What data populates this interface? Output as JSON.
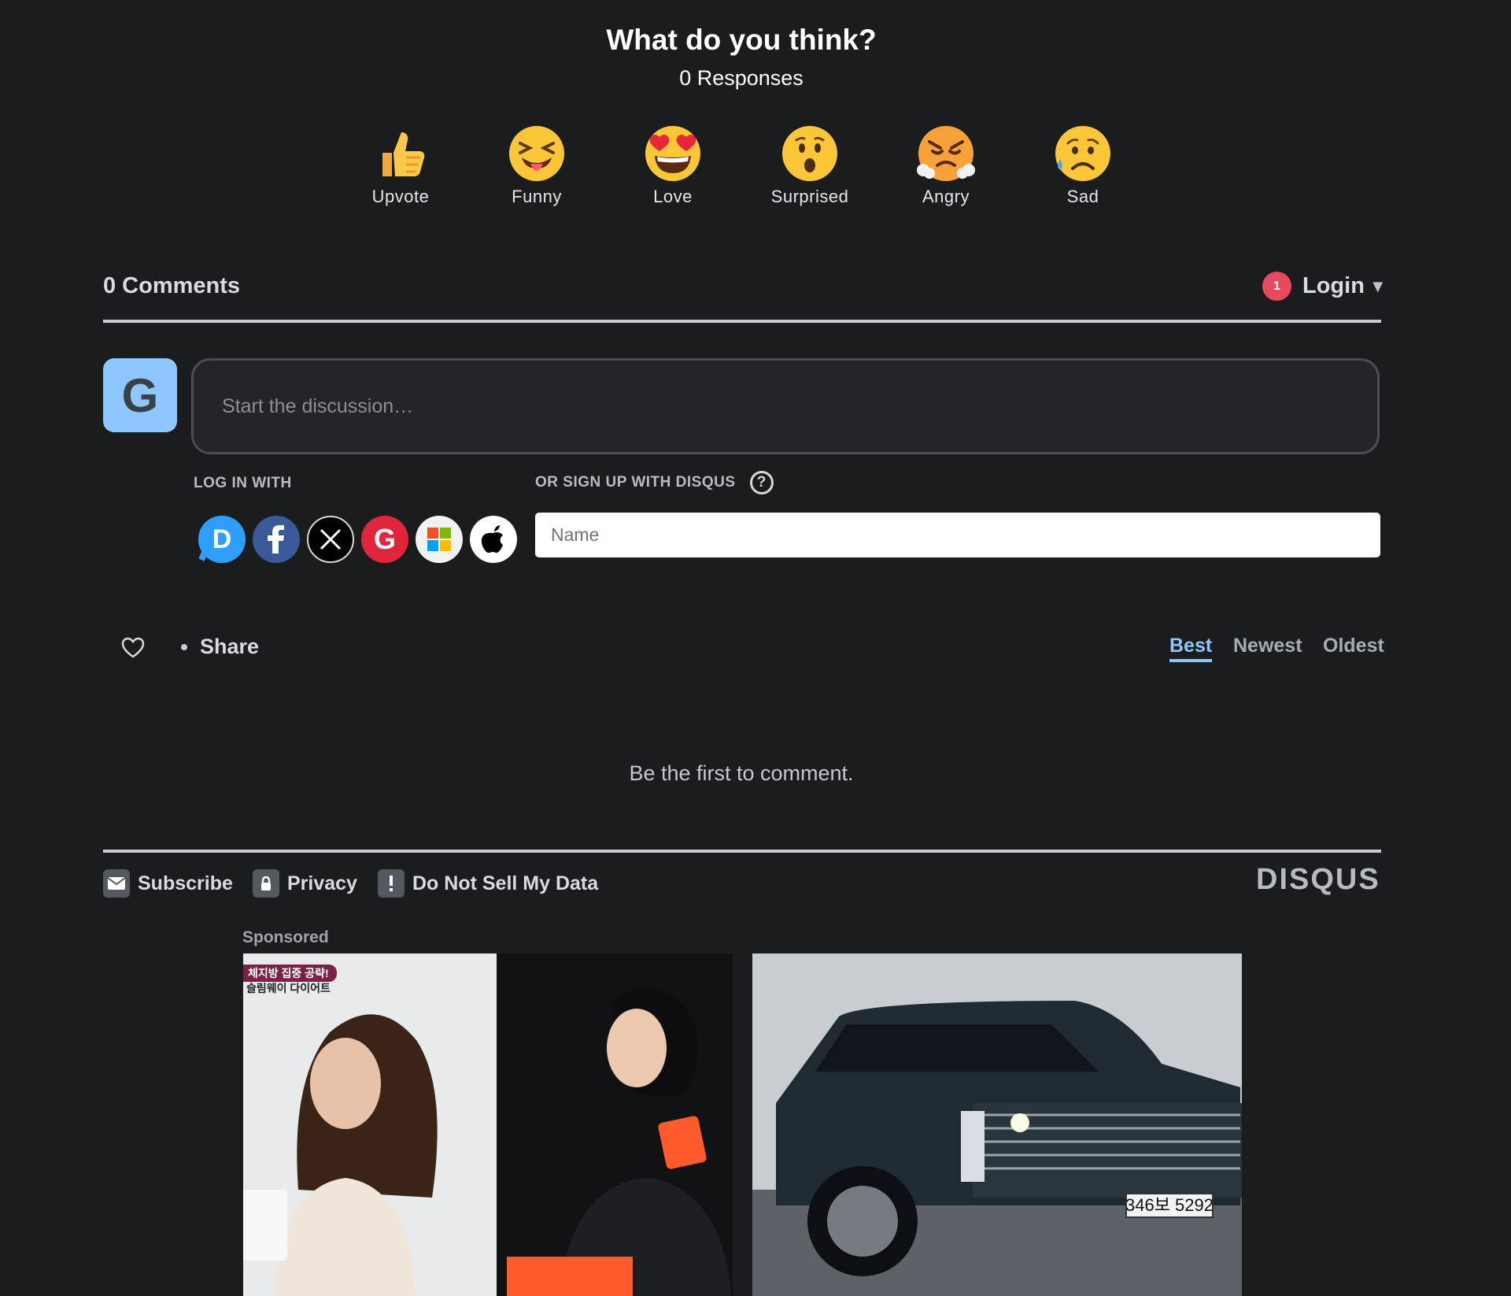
{
  "reactions": {
    "title": "What do you think?",
    "count": "0 Responses",
    "items": [
      {
        "label": "Upvote",
        "icon": "thumbs-up-icon"
      },
      {
        "label": "Funny",
        "icon": "funny-face-icon"
      },
      {
        "label": "Love",
        "icon": "heart-eyes-icon"
      },
      {
        "label": "Surprised",
        "icon": "surprised-face-icon"
      },
      {
        "label": "Angry",
        "icon": "angry-face-icon"
      },
      {
        "label": "Sad",
        "icon": "sad-face-icon"
      }
    ]
  },
  "comments": {
    "count": "0 Comments",
    "login_badge": "1",
    "login_label": "Login",
    "avatar_letter": "G",
    "composer_placeholder": "Start the discussion…",
    "log_in_with": "LOG IN WITH",
    "sign_up": "OR SIGN UP WITH DISQUS",
    "help": "?",
    "name_placeholder": "Name",
    "social": [
      "disqus-icon",
      "facebook-icon",
      "x-icon",
      "google-icon",
      "microsoft-icon",
      "apple-icon"
    ],
    "share": "Share",
    "sort": {
      "best": "Best",
      "newest": "Newest",
      "oldest": "Oldest",
      "active": "Best"
    },
    "empty": "Be the first to comment."
  },
  "footer": {
    "subscribe": "Subscribe",
    "privacy": "Privacy",
    "do_not_sell": "Do Not Sell My Data",
    "logo": "DISQUS"
  },
  "sponsored": {
    "label": "Sponsored",
    "ad1_caption_top": "체지방 집중 공략!",
    "ad1_caption_bottom": "슬림웨이 다이어트",
    "ad2_plate": "346보 5292"
  },
  "colors": {
    "background": "#1b1c1e",
    "accent": "#8ec6ff",
    "badge": "#e9495c"
  }
}
